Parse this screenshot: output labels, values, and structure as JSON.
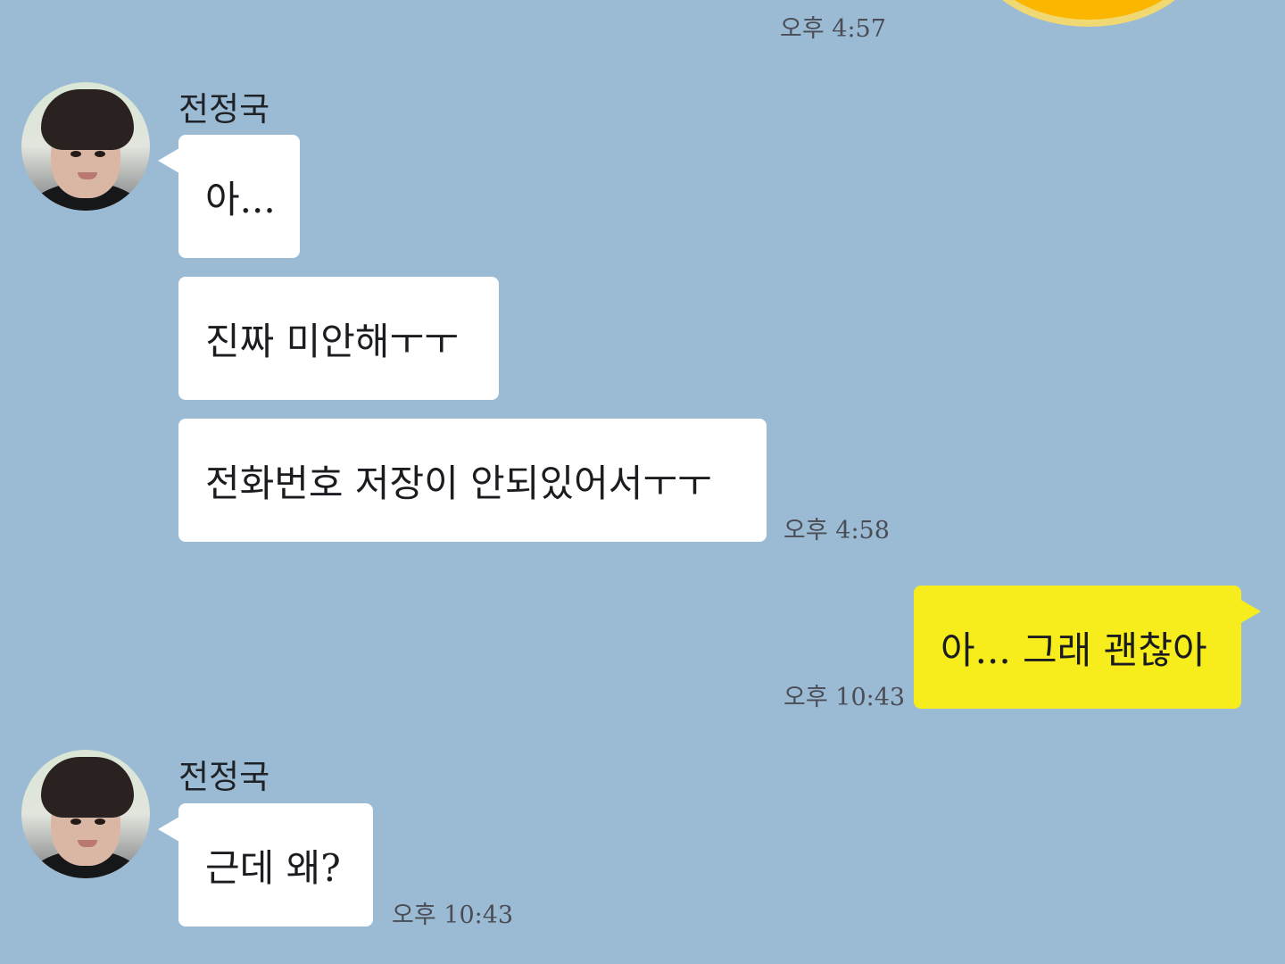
{
  "top": {
    "time": "오후 4:57",
    "emoticon_icon": "emoticon-sticker-icon"
  },
  "thread": {
    "incoming_1": {
      "sender_name": "전정국",
      "avatar_icon": "profile-photo-avatar",
      "messages": [
        "아...",
        "진짜 미안해ㅜㅜ",
        "전화번호 저장이 안되있어서ㅜㅜ"
      ],
      "time": "오후 4:58"
    },
    "outgoing_1": {
      "message": "아... 그래 괜찮아",
      "time": "오후 10:43"
    },
    "incoming_2": {
      "sender_name": "전정국",
      "avatar_icon": "profile-photo-avatar",
      "message": "근데 왜?",
      "time": "오후 10:43"
    }
  },
  "colors": {
    "background": "#9bbbd4",
    "incoming_bubble": "#ffffff",
    "outgoing_bubble": "#f7ec1c",
    "timestamp_text": "#4a4d55"
  }
}
